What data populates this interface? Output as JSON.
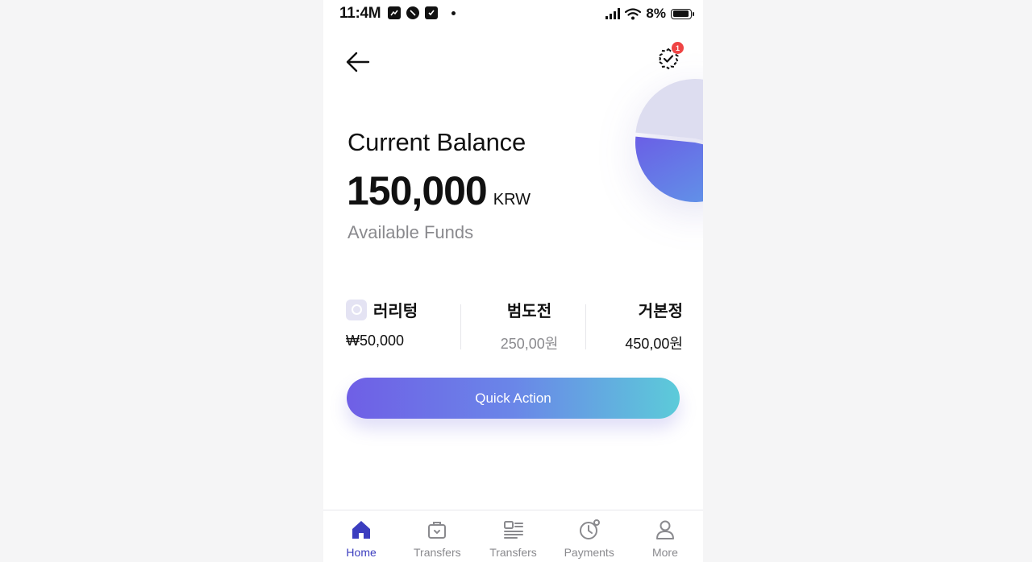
{
  "status_bar": {
    "time": "11:4M",
    "battery": "8%"
  },
  "header": {
    "back_icon": "arrow-left-icon",
    "task_icon": "badge-check-icon",
    "notification_count": "1"
  },
  "balance": {
    "title": "Current Balance",
    "amount": "150,000",
    "currency": "KRW",
    "subtitle": "Available Funds"
  },
  "stats": [
    {
      "label": "러리텅",
      "value": "₩50,000"
    },
    {
      "label": "범도전",
      "value": "250,00원"
    },
    {
      "label": "거본정",
      "value": "450,00원"
    }
  ],
  "actions": {
    "quick_action": "Quick Action"
  },
  "pie": {
    "slices": [
      {
        "fraction": 0.52,
        "color": "#ddddf0"
      },
      {
        "fraction": 0.48,
        "color": "#6a6ee8"
      }
    ]
  },
  "nav": {
    "items": [
      {
        "label": "Home",
        "icon": "home-icon",
        "active": true
      },
      {
        "label": "Transfers",
        "icon": "briefcase-icon",
        "active": false
      },
      {
        "label": "Transfers",
        "icon": "receipt-icon",
        "active": false
      },
      {
        "label": "Payments",
        "icon": "clock-icon",
        "active": false
      },
      {
        "label": "More",
        "icon": "user-icon",
        "active": false
      }
    ]
  },
  "colors": {
    "accent": "#3b3dbf",
    "gradient_start": "#6f5fe6",
    "gradient_end": "#5ccbd9",
    "badge": "#ef4444"
  }
}
